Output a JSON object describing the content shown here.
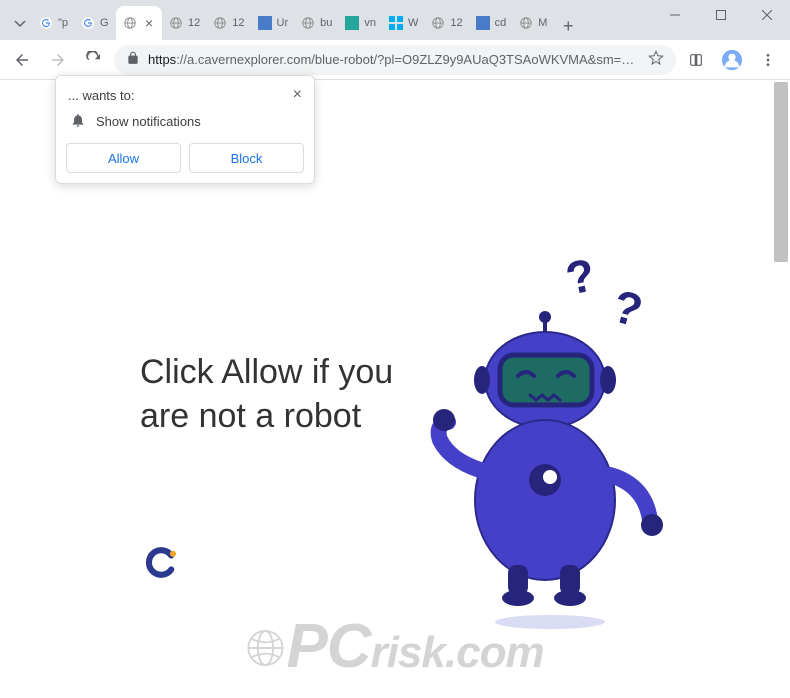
{
  "tabs": [
    {
      "label": "\"p",
      "icon": "google"
    },
    {
      "label": "G",
      "icon": "google"
    },
    {
      "label": "",
      "icon": "globe",
      "active": true
    },
    {
      "label": "12",
      "icon": "globe"
    },
    {
      "label": "12",
      "icon": "globe"
    },
    {
      "label": "Ur",
      "icon": "blue"
    },
    {
      "label": "bu",
      "icon": "globe"
    },
    {
      "label": "vn",
      "icon": "teal"
    },
    {
      "label": "W",
      "icon": "win"
    },
    {
      "label": "12",
      "icon": "globe"
    },
    {
      "label": "cd",
      "icon": "blue"
    },
    {
      "label": "M",
      "icon": "globe"
    }
  ],
  "address": {
    "url_prefix": "https",
    "url": "://a.cavernexplorer.com/blue-robot/?pl=O9ZLZ9y9AUaQ3TSAoWKVMA&sm=blue-robot&click_id..."
  },
  "notification": {
    "title": "... wants to:",
    "body": "Show notifications",
    "allow": "Allow",
    "block": "Block"
  },
  "page": {
    "headline": "Click Allow if you are not a robot"
  },
  "watermark": {
    "pc": "PC",
    "rest": "risk.com"
  }
}
